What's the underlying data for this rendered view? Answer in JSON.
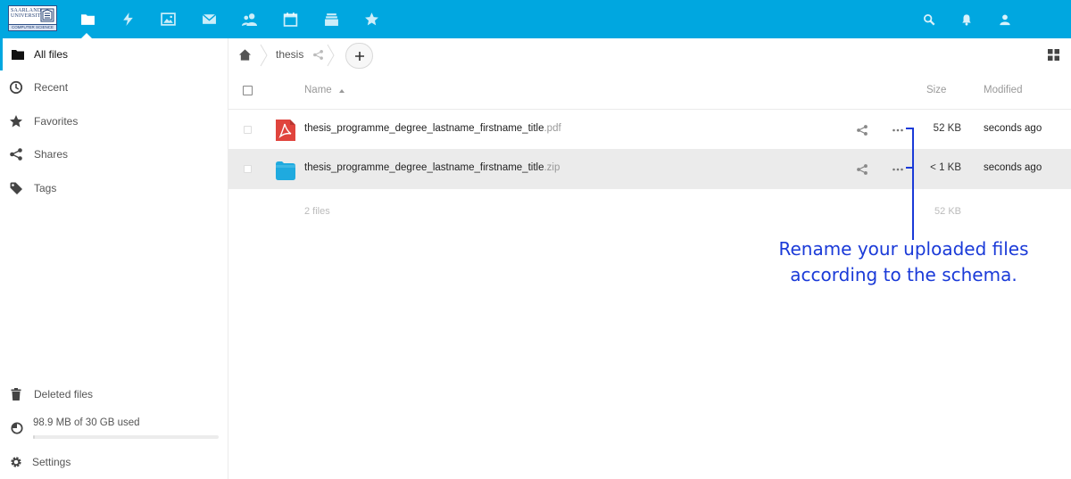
{
  "colors": {
    "header": "#00a7e0",
    "annotation": "#1a3ad8",
    "pdf": "#e0443d",
    "zip": "#1faadf"
  },
  "logo": {
    "line1": "SAARLAND UNIVERSITY",
    "line2": "COMPUTER SCIENCE"
  },
  "header": {
    "apps": [
      "files-icon",
      "activity-icon",
      "gallery-icon",
      "mail-icon",
      "contacts-icon",
      "calendar-icon",
      "deck-icon",
      "starred-icon"
    ],
    "right": [
      "search-icon",
      "notifications-icon",
      "user-icon"
    ]
  },
  "sidebar": {
    "items": [
      {
        "label": "All files",
        "icon": "folder-icon"
      },
      {
        "label": "Recent",
        "icon": "clock-icon"
      },
      {
        "label": "Favorites",
        "icon": "star-icon"
      },
      {
        "label": "Shares",
        "icon": "share-icon"
      },
      {
        "label": "Tags",
        "icon": "tag-icon"
      }
    ],
    "deleted": "Deleted files",
    "quota": {
      "text": "98.9 MB of 30 GB used",
      "fraction": 0.003
    },
    "settings": "Settings"
  },
  "breadcrumb": {
    "current": "thesis"
  },
  "table": {
    "headers": {
      "name": "Name",
      "size": "Size",
      "modified": "Modified"
    },
    "rows": [
      {
        "basename": "thesis_programme_degree_lastname_firstname_title",
        "ext": ".pdf",
        "size": "52 KB",
        "modified": "seconds ago",
        "type": "pdf"
      },
      {
        "basename": "thesis_programme_degree_lastname_firstname_title",
        "ext": ".zip",
        "size": "< 1 KB",
        "modified": "seconds ago",
        "type": "zip"
      }
    ],
    "summary": {
      "count": "2 files",
      "size": "52 KB"
    }
  },
  "annotation": {
    "line1": "Rename your uploaded files",
    "line2": "according to the schema."
  }
}
